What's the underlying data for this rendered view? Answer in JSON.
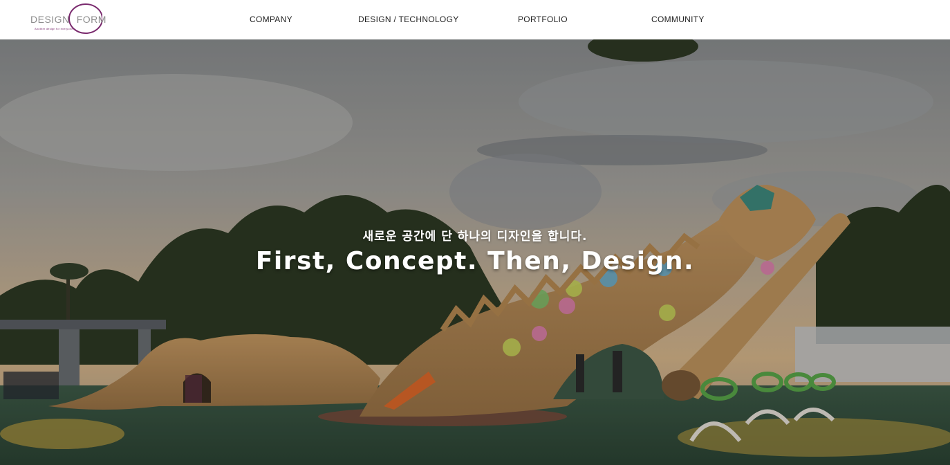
{
  "logo": {
    "word1": "DESIGN",
    "word2": "FORM",
    "tagline": "Another design for everyone",
    "ring_color": "#7a2a6e"
  },
  "nav": {
    "items": [
      {
        "label": "COMPANY"
      },
      {
        "label": "DESIGN / TECHNOLOGY"
      },
      {
        "label": "PORTFOLIO"
      },
      {
        "label": "COMMUNITY"
      }
    ]
  },
  "hero": {
    "subtitle": "새로운 공간에 단 하나의 디자인을 합니다.",
    "title": "First, Concept. Then, Design.",
    "image": "dragon-playground-photo"
  }
}
